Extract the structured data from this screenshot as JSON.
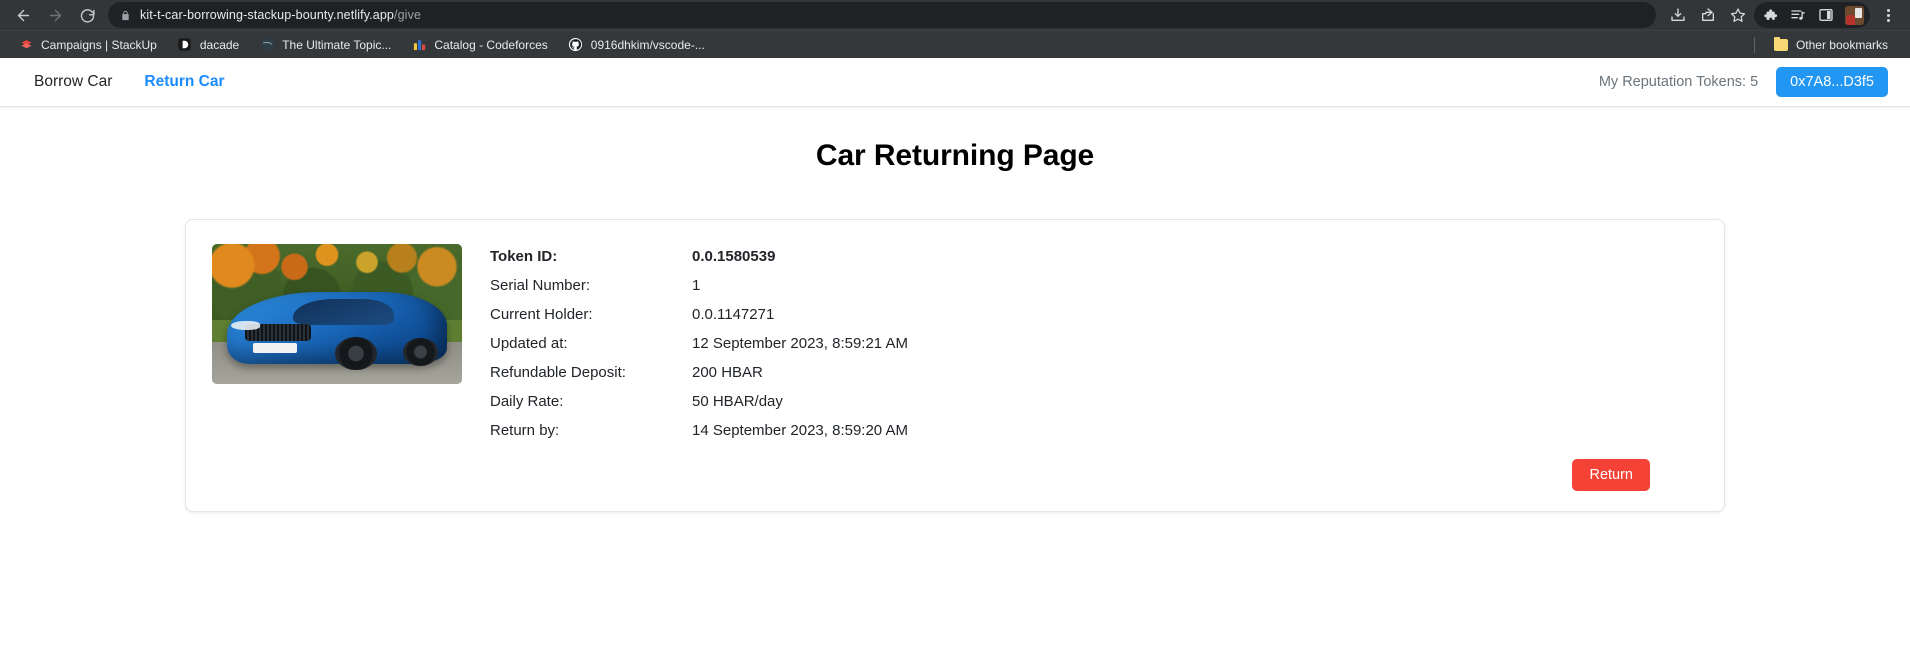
{
  "browser": {
    "nav": {
      "back_title": "Back",
      "forward_title": "Forward",
      "reload_title": "Reload"
    },
    "omnibox": {
      "lock_icon": "lock-icon",
      "url_domain": "kit-t-car-borrowing-stackup-bounty.netlify.app",
      "url_path": "/give"
    },
    "toolbar_icons": [
      {
        "name": "downloads-icon",
        "title": "Downloads"
      },
      {
        "name": "share-icon",
        "title": "Share this page"
      },
      {
        "name": "bookmark-star-icon",
        "title": "Bookmark this tab"
      },
      {
        "name": "extensions-puzzle-icon",
        "title": "Extensions"
      },
      {
        "name": "media-playlist-icon",
        "title": "Media"
      },
      {
        "name": "side-panel-icon",
        "title": "Side panel"
      },
      {
        "name": "profile-avatar-icon",
        "title": "Profile"
      },
      {
        "name": "chrome-menu-kebab-icon",
        "title": "Customize and control Google Chrome"
      }
    ],
    "bookmarks": [
      {
        "label": "Campaigns | StackUp",
        "icon": "stackup-icon"
      },
      {
        "label": "dacade",
        "icon": "dacade-icon"
      },
      {
        "label": "The Ultimate Topic...",
        "icon": "globe-icon"
      },
      {
        "label": "Catalog - Codeforces",
        "icon": "codeforces-icon"
      },
      {
        "label": "0916dhkim/vscode-...",
        "icon": "github-icon"
      }
    ],
    "other_bookmarks": {
      "label": "Other bookmarks",
      "icon": "folder-icon"
    }
  },
  "app": {
    "navbar": {
      "links": [
        {
          "label": "Borrow Car",
          "active": false
        },
        {
          "label": "Return Car",
          "active": true
        }
      ],
      "reputation_tokens": "My Reputation Tokens: 5",
      "account_button": "0x7A8...D3f5"
    },
    "page_title": "Car Returning Page",
    "card": {
      "car_image_alt": "blue-bmw-car-photo",
      "details": [
        {
          "label": "Token ID:",
          "value": "0.0.1580539",
          "emphasis": true
        },
        {
          "label": "Serial Number:",
          "value": "1",
          "emphasis": false
        },
        {
          "label": "Current Holder:",
          "value": "0.0.1147271",
          "emphasis": false
        },
        {
          "label": "Updated at:",
          "value": "12 September 2023, 8:59:21 AM",
          "emphasis": false
        },
        {
          "label": "Refundable Deposit:",
          "value": "200 HBAR",
          "emphasis": false
        },
        {
          "label": "Daily Rate:",
          "value": "50 HBAR/day",
          "emphasis": false
        },
        {
          "label": "Return by:",
          "value": "14 September 2023, 8:59:20 AM",
          "emphasis": false
        }
      ],
      "return_button": "Return"
    }
  },
  "colors": {
    "chrome_toolbar": "#323639",
    "chrome_bookmarks": "#35383b",
    "omnibox": "#202124",
    "accent_blue": "#1a8cff",
    "account_blue": "#2196f3",
    "danger_red": "#f44336",
    "text_dark": "#212529",
    "text_muted": "#6c757d"
  }
}
